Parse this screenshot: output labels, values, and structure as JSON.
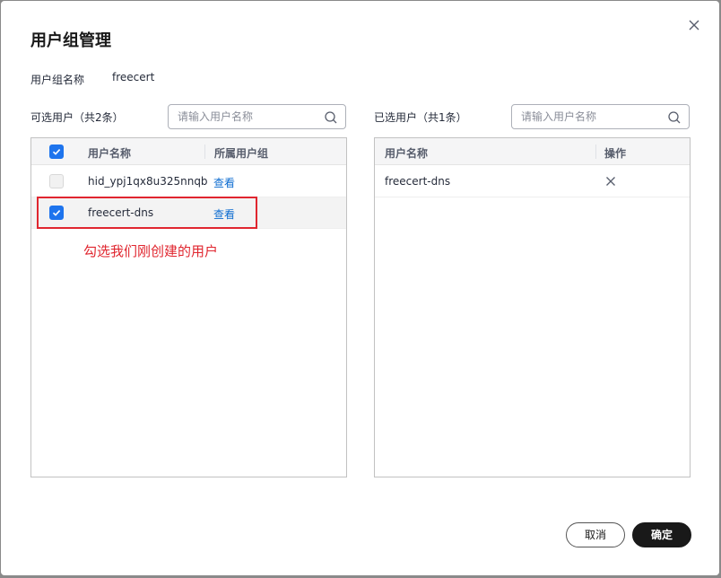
{
  "dialog": {
    "title": "用户组管理",
    "group_name_label": "用户组名称",
    "group_name_value": "freecert"
  },
  "available": {
    "label": "可选用户（共2条）",
    "search_placeholder": "请输入用户名称",
    "columns": [
      "用户名称",
      "所属用户组"
    ],
    "rows": [
      {
        "name": "hid_ypj1qx8u325nnqb",
        "action": "查看",
        "checked": false
      },
      {
        "name": "freecert-dns",
        "action": "查看",
        "checked": true
      }
    ],
    "annotation": "勾选我们刚创建的用户"
  },
  "selected": {
    "label": "已选用户（共1条）",
    "search_placeholder": "请输入用户名称",
    "columns": [
      "用户名称",
      "操作"
    ],
    "rows": [
      {
        "name": "freecert-dns"
      }
    ]
  },
  "footer": {
    "cancel_label": "取消",
    "ok_label": "确定"
  },
  "colors": {
    "accent": "#1e74ed",
    "link": "#0d6cd0",
    "annotation": "#e0262f",
    "primary_button": "#191919"
  }
}
